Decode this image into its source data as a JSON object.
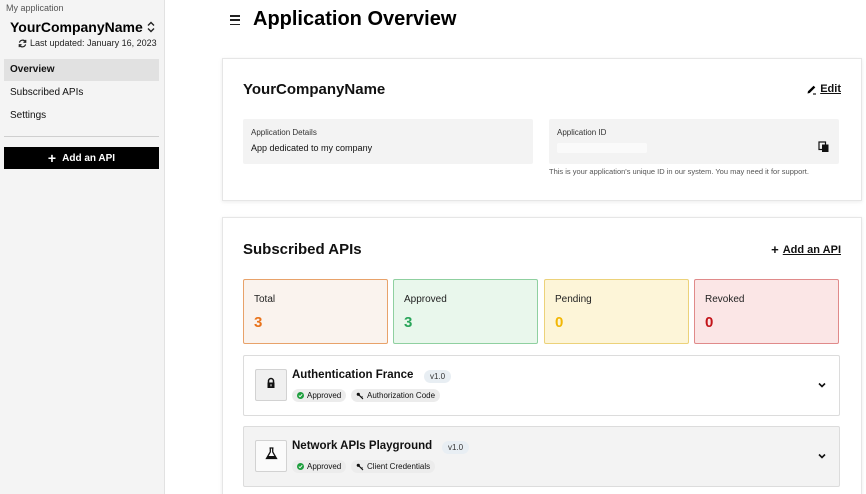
{
  "sidebar": {
    "caption": "My application",
    "app_name": "YourCompanyName",
    "last_updated": "Last updated: January 16, 2023",
    "nav": [
      {
        "label": "Overview",
        "active": true
      },
      {
        "label": "Subscribed APIs",
        "active": false
      },
      {
        "label": "Settings",
        "active": false
      }
    ],
    "add_api_label": "Add an API"
  },
  "header": {
    "title": "Application Overview"
  },
  "overview": {
    "company_name": "YourCompanyName",
    "edit_label": "Edit",
    "details_label": "Application Details",
    "details_value": "App dedicated to my company",
    "id_label": "Application ID",
    "id_hint": "This is your application's unique ID in our system. You may need it for support."
  },
  "apis": {
    "title": "Subscribed APIs",
    "add_label": "Add an API",
    "stats": [
      {
        "label": "Total",
        "value": "3",
        "color": "#e8731c",
        "bg": "#faf3ee",
        "border": "#e8a26a"
      },
      {
        "label": "Approved",
        "value": "3",
        "color": "#2aa55a",
        "bg": "#e9f7ec",
        "border": "#8fd0a0"
      },
      {
        "label": "Pending",
        "value": "0",
        "color": "#f2b705",
        "bg": "#fdf5d8",
        "border": "#ecd27a"
      },
      {
        "label": "Revoked",
        "value": "0",
        "color": "#c3141a",
        "bg": "#fbe6e6",
        "border": "#e08a8a"
      }
    ],
    "items": [
      {
        "name": "Authentication France",
        "version": "v1.0",
        "status": "Approved",
        "auth": "Authorization Code",
        "icon": "lock-icon"
      },
      {
        "name": "Network APIs Playground",
        "version": "v1.0",
        "status": "Approved",
        "auth": "Client Credentials",
        "icon": "flask-icon"
      }
    ]
  }
}
